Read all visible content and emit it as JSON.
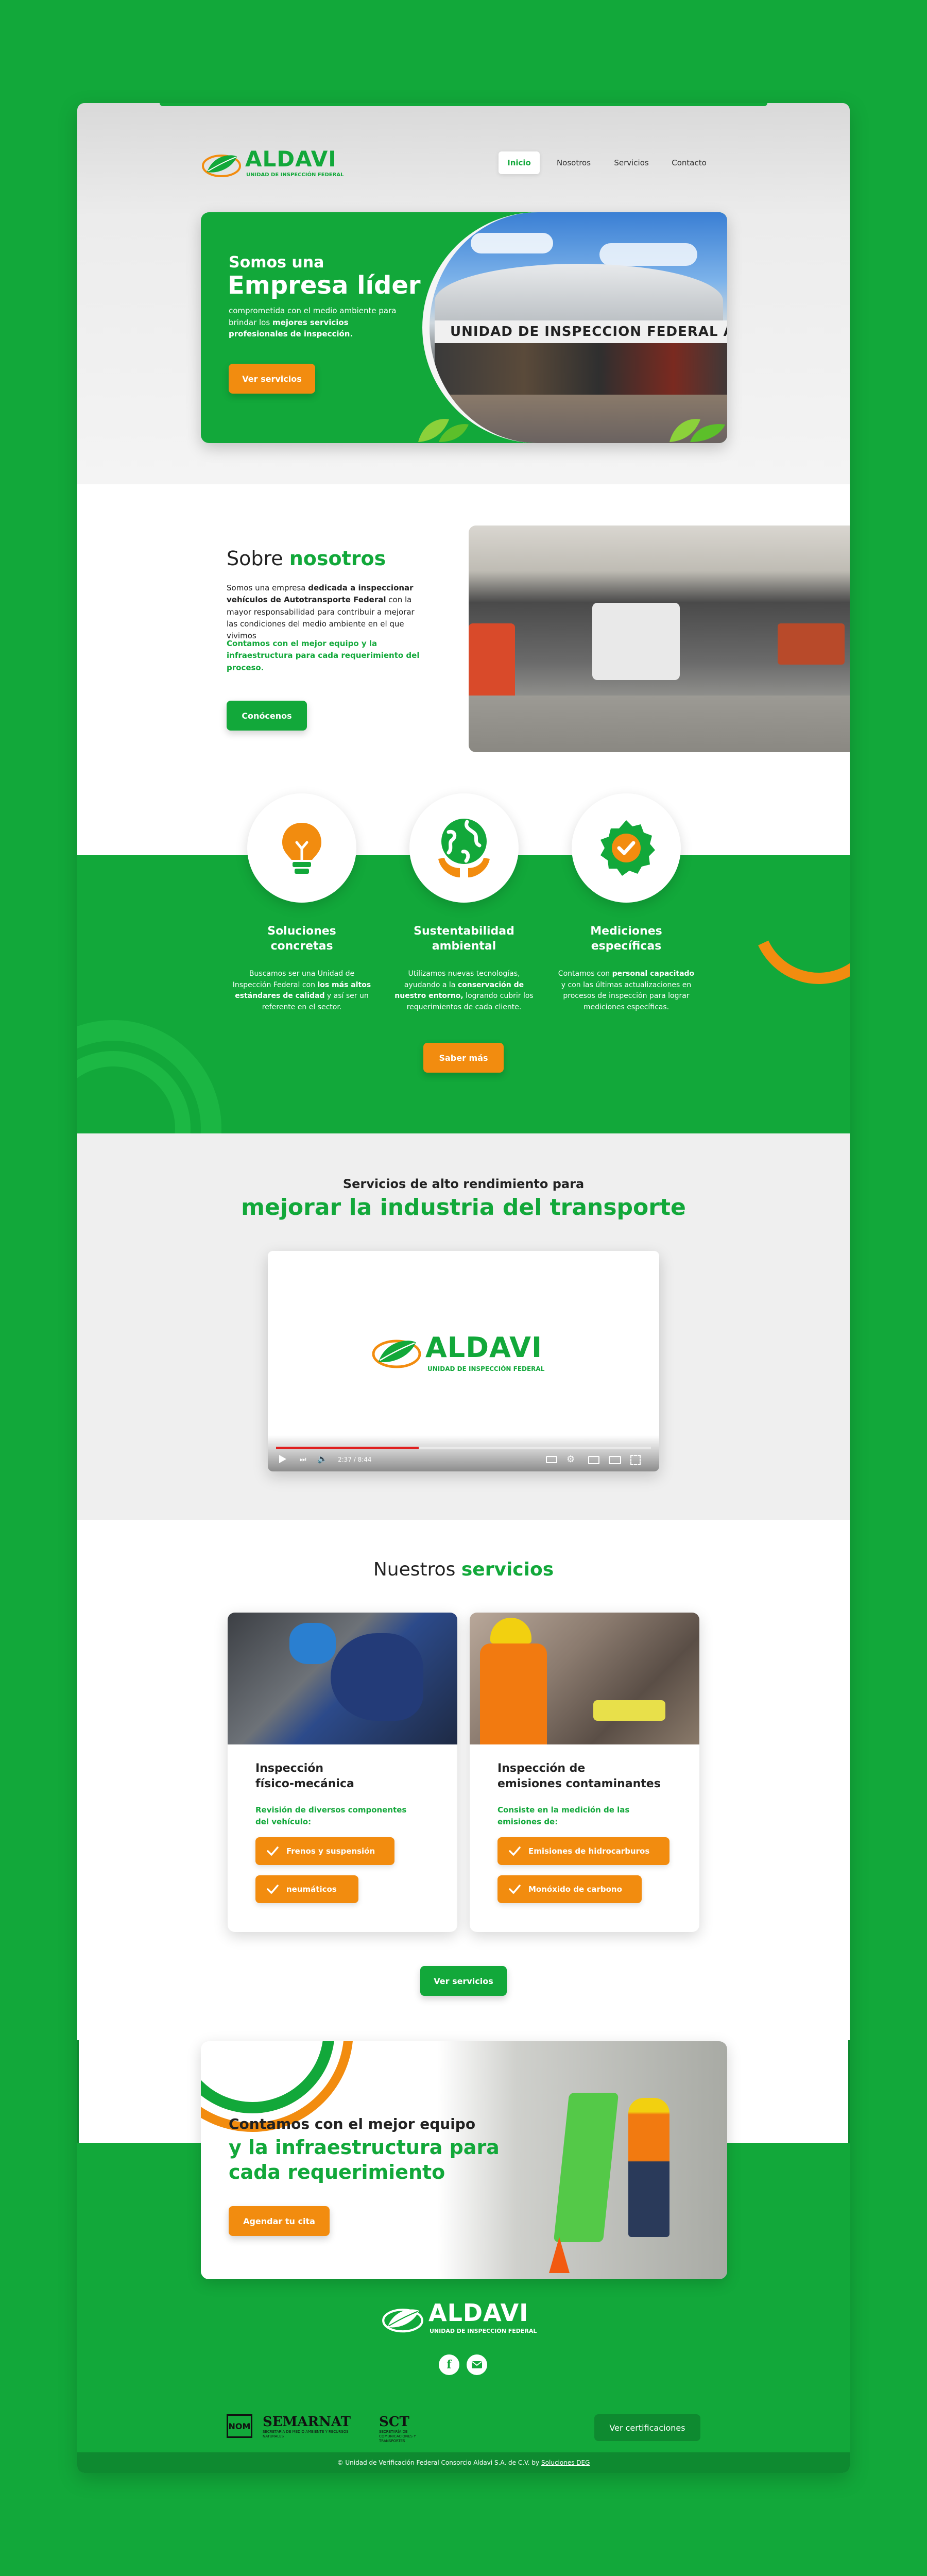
{
  "brand": {
    "name": "ALDAVI",
    "tagline": "UNIDAD DE INSPECCIÓN FEDERAL",
    "colors": {
      "green": "#12a83a",
      "orange": "#f28c0f",
      "dark": "#1a1a1a"
    }
  },
  "nav": {
    "items": [
      {
        "label": "Inicio",
        "active": true
      },
      {
        "label": "Nosotros",
        "active": false
      },
      {
        "label": "Servicios",
        "active": false
      },
      {
        "label": "Contacto",
        "active": false
      }
    ]
  },
  "hero": {
    "line1": "Somos una",
    "line2": "Empresa líder",
    "desc_a": "comprometida con el medio ambiente para brindar los ",
    "desc_b": "mejores servicios profesionales de inspección.",
    "button": "Ver servicios",
    "photo_sign": "UNIDAD DE INSPECCION FEDERAL ALDAVI"
  },
  "about": {
    "title_a": "Sobre ",
    "title_b": "nosotros",
    "p1_a": "Somos una empresa ",
    "p1_b": "dedicada a inspeccionar vehículos de Autotransporte Federal",
    "p1_c": " con la mayor responsabilidad para contribuir a mejorar las condiciones del medio ambiente en el que vivimos",
    "p2": "Contamos con el mejor equipo y la infraestructura para cada requerimiento del proceso.",
    "button": "Conócenos"
  },
  "features": {
    "items": [
      {
        "icon": "lightbulb-icon",
        "title": "Soluciones concretas",
        "text_a": "Buscamos ser una Unidad de Inspección Federal con ",
        "text_b": "los más altos estándares de calidad",
        "text_c": " y así ser un referente en el sector."
      },
      {
        "icon": "globe-hands-icon",
        "title": "Sustentabilidad ambiental",
        "text_a": "Utilizamos nuevas tecnologías, ayudando a la ",
        "text_b": "conservación de nuestro entorno,",
        "text_c": " logrando cubrir los requerimientos de cada cliente."
      },
      {
        "icon": "badge-check-icon",
        "title": "Mediciones específicas",
        "text_a": "Contamos con ",
        "text_b": "personal capacitado",
        "text_c": " y con las últimas actualizaciones en procesos de inspección para lograr mediciones específicas."
      }
    ],
    "button": "Saber más"
  },
  "video": {
    "subtitle": "Servicios de alto rendimiento para",
    "title": "mejorar la industria del transporte",
    "time": "2:37 / 8:44",
    "progress": 0.38
  },
  "services": {
    "title_a": "Nuestros ",
    "title_b": "servicios",
    "cards": [
      {
        "title_1": "Inspección",
        "title_2": "físico-mecánica",
        "desc": "Revisión de diversos componentes del vehículo:",
        "pills": [
          "Frenos y suspensión",
          "neumáticos"
        ]
      },
      {
        "title_1": "Inspección de",
        "title_2": "emisiones contaminantes",
        "desc": "Consiste en la medición de las emisiones de:",
        "pills": [
          "Emisiones de hidrocarburos",
          "Monóxido de carbono"
        ]
      }
    ],
    "button": "Ver servicios"
  },
  "cta": {
    "line1": "Contamos con el mejor equipo",
    "line2": "y la infraestructura para",
    "line3": "cada requerimiento",
    "button": "Agendar tu cita"
  },
  "footer": {
    "certs": [
      "NOM",
      "SEMARNAT",
      "SCT"
    ],
    "semarnat_sub": "SECRETARÍA DE MEDIO AMBIENTE Y RECURSOS NATURALES",
    "sct_sub": "SECRETARÍA DE COMUNICACIONES Y TRANSPORTES",
    "cert_button": "Ver certificaciones",
    "copyright_a": "© Unidad de Verificación Federal Consorcio Aldavi S.A. de C.V. by ",
    "copyright_link": "Soluciones DEG"
  }
}
